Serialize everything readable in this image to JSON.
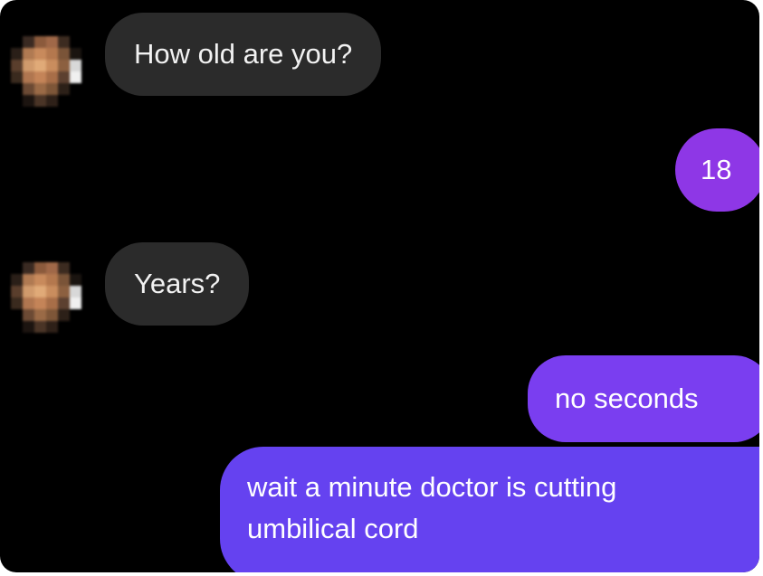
{
  "colors": {
    "background": "#000000",
    "incoming_bubble": "#2b2b2b",
    "outgoing_purple": "#8e37e6",
    "outgoing_violet": "#7a3ef0",
    "outgoing_indigo": "#6542f0",
    "text": "#f2f2f2"
  },
  "conversation": {
    "messages": [
      {
        "sender": "other",
        "text": "How old are you?",
        "avatar_icon": "pixelated-avatar-icon"
      },
      {
        "sender": "me",
        "text": "18"
      },
      {
        "sender": "other",
        "text": "Years?",
        "avatar_icon": "pixelated-avatar-icon"
      },
      {
        "sender": "me",
        "text": "no seconds"
      },
      {
        "sender": "me",
        "lines": [
          "wait a minute doctor is cutting",
          "umbilical cord"
        ]
      }
    ]
  }
}
